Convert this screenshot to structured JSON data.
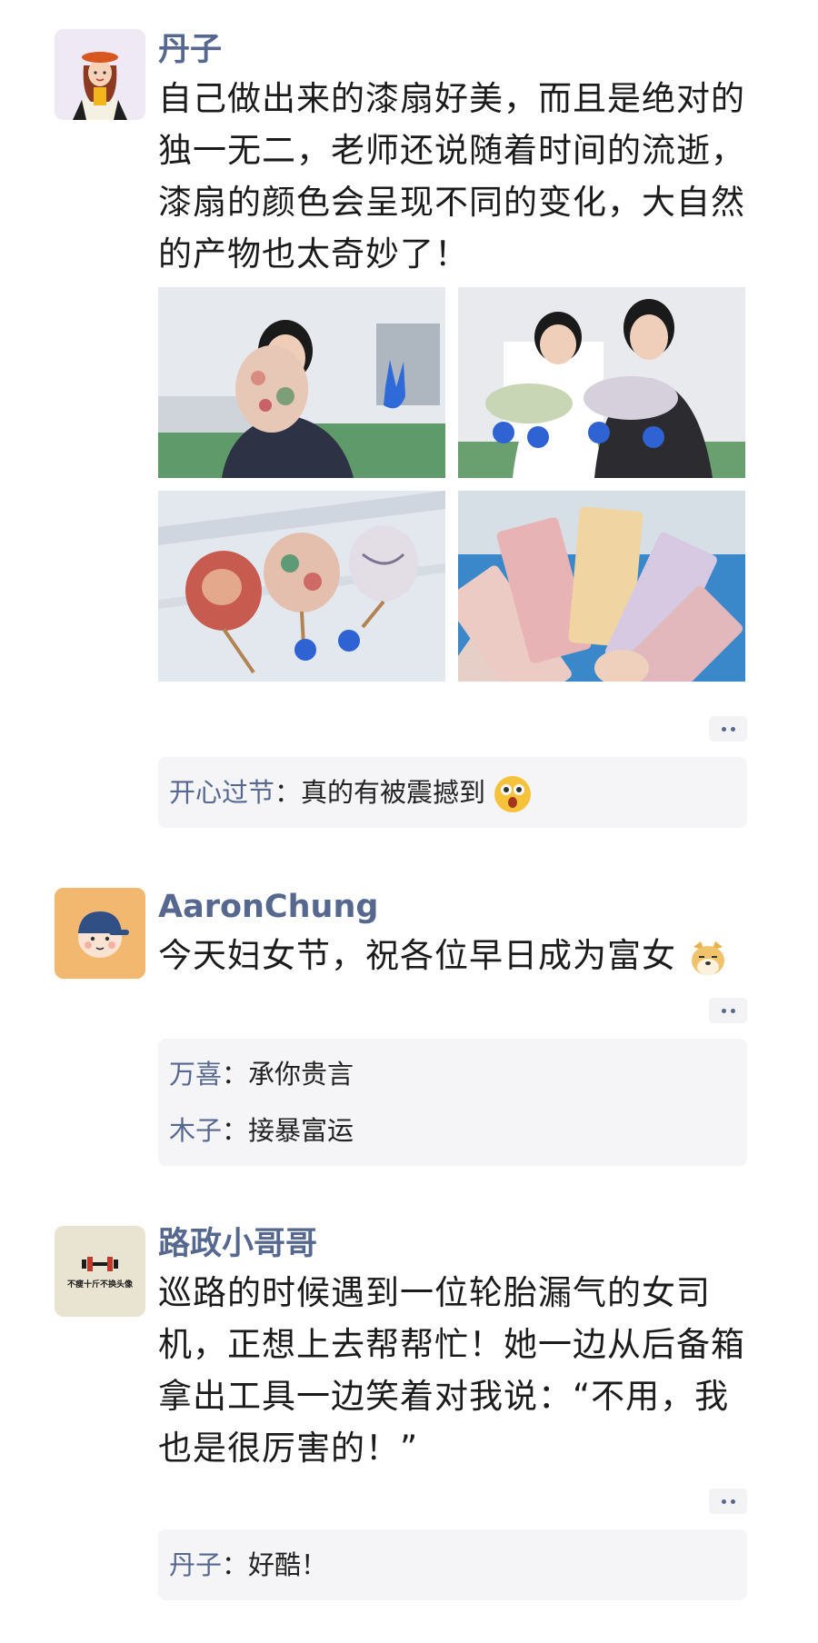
{
  "posts": [
    {
      "name": "丹子",
      "text": "自己做出来的漆扇好美，而且是绝对的独一无二，老师还说随着时间的流逝，漆扇的颜色会呈现不同的变化，大自然的产物也太奇妙了！",
      "comments": [
        {
          "author": "开心过节",
          "sep": "：",
          "text": "真的有被震撼到"
        }
      ]
    },
    {
      "name": "AaronChung",
      "text": "今天妇女节，祝各位早日成为富女",
      "comments": [
        {
          "author": "万喜",
          "sep": "：",
          "text": "承你贵言"
        },
        {
          "author": "木子",
          "sep": "：",
          "text": "接暴富运"
        }
      ]
    },
    {
      "name": "路政小哥哥",
      "avatar_text": "不瘦十斤不换头像",
      "text": "巡路的时候遇到一位轮胎漏气的女司机，正想上去帮帮忙！她一边从后备箱拿出工具一边笑着对我说：“不用，我也是很厉害的！”",
      "comments": [
        {
          "author": "丹子",
          "sep": "：",
          "text": "好酷！"
        }
      ]
    }
  ],
  "icons": {
    "more": "more-dots-icon",
    "emoji_shock": "shocked-face-emoji",
    "emoji_doge": "doge-emoji",
    "dumbbell": "dumbbell-icon"
  },
  "colors": {
    "name": "#56688f",
    "comment_bg": "#f5f5f7"
  }
}
